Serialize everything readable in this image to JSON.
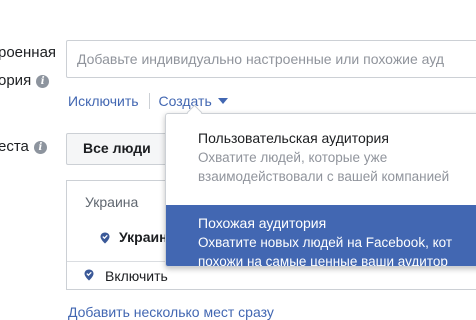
{
  "left_labels": {
    "audience_line1": "роенная",
    "audience_line2": "ория",
    "locations_label": "еста"
  },
  "audience": {
    "placeholder": "Добавьте индивидуально настроенные или похожие ауд",
    "exclude_link": "Исключить",
    "create_link": "Создать"
  },
  "people_select": {
    "value": "Все люди"
  },
  "locations": {
    "country": "Украина",
    "selected": "Украин",
    "include": "Включить",
    "add_many_link": "Добавить несколько мест сразу"
  },
  "create_menu": {
    "items": [
      {
        "title": "Пользовательская аудитория",
        "desc_line1": "Охватите людей, которые уже",
        "desc_line2": "взаимодействовали с вашей компанией"
      },
      {
        "title": "Похожая аудитория",
        "desc_line1": "Охватите новых людей на Facebook, кот",
        "desc_line2": "похожи на самые ценные ваши аудитор"
      }
    ],
    "highlighted_index": 1
  },
  "colors": {
    "link": "#4267b2",
    "highlight": "#4267b2",
    "icon": "#3b5998"
  },
  "icons": [
    "info-icon",
    "caret-down-icon",
    "location-pin-icon"
  ]
}
